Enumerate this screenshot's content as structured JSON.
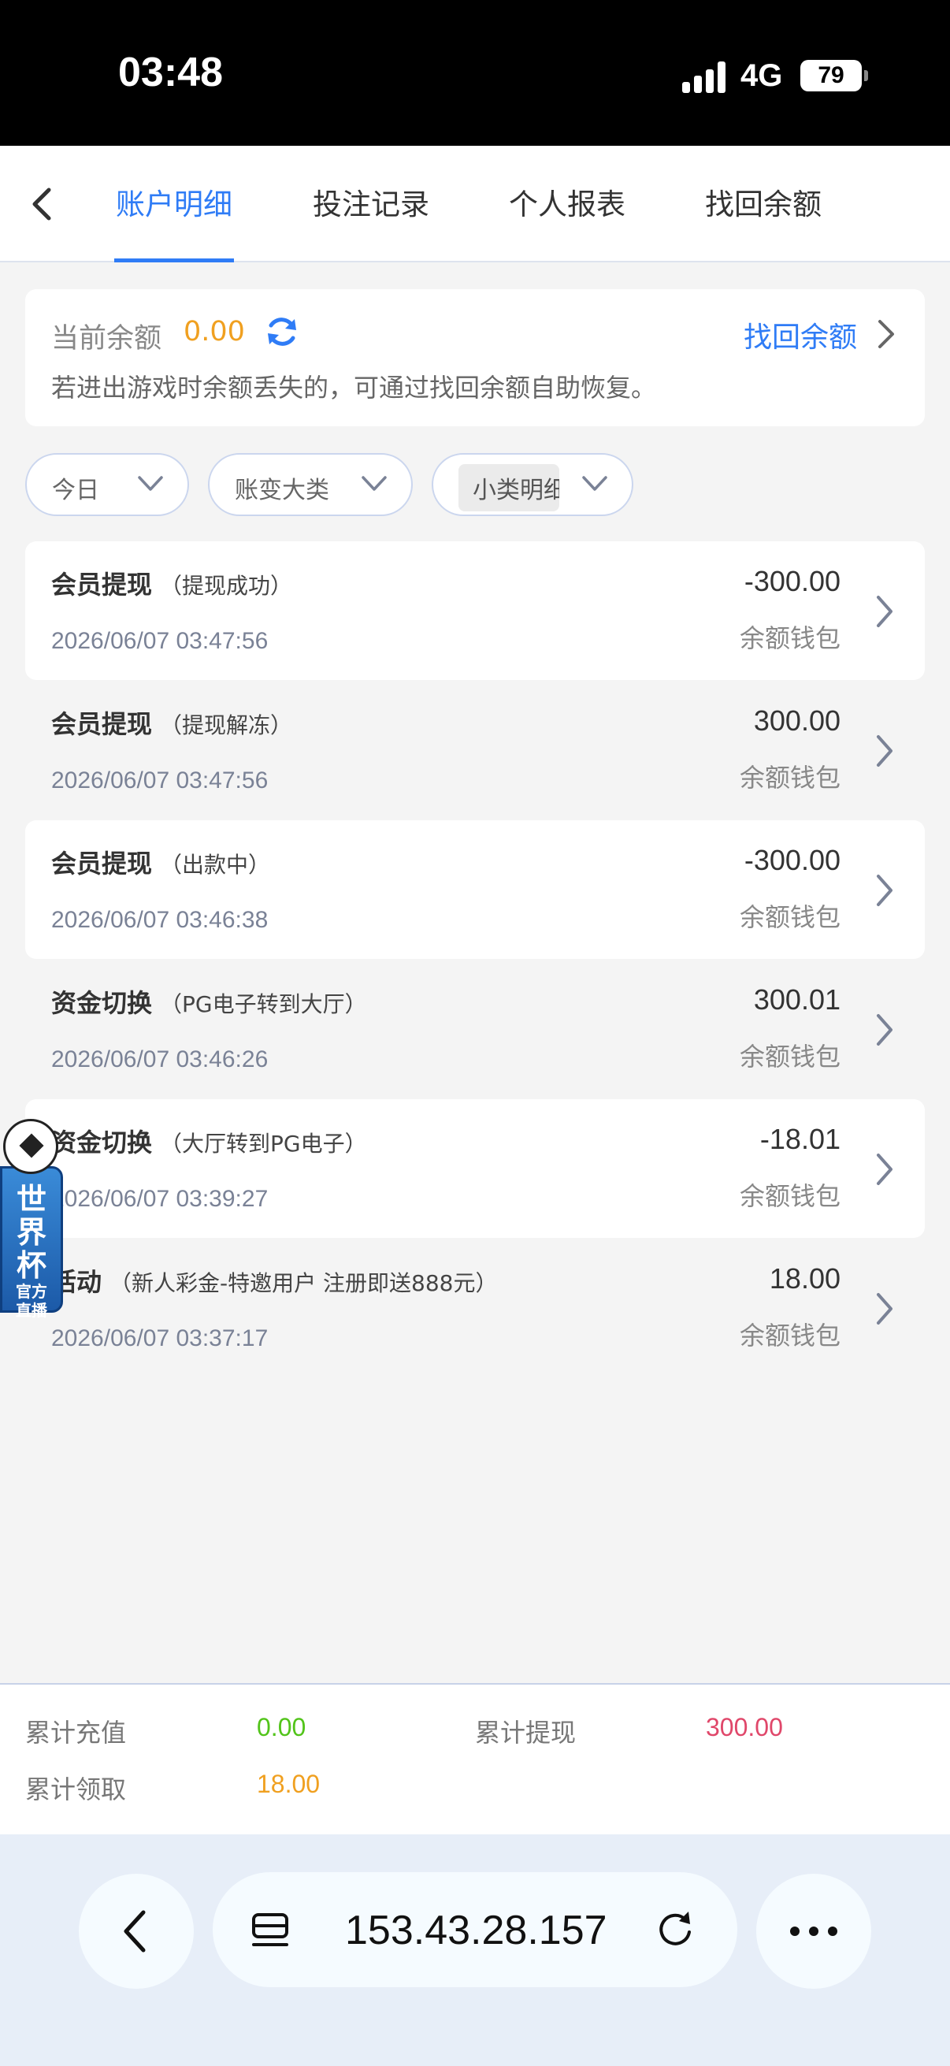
{
  "status_bar": {
    "time": "03:48",
    "network": "4G",
    "battery": "79"
  },
  "tabs": [
    {
      "label": "账户明细",
      "active": true
    },
    {
      "label": "投注记录",
      "active": false
    },
    {
      "label": "个人报表",
      "active": false
    },
    {
      "label": "找回余额",
      "active": false
    }
  ],
  "balance": {
    "label": "当前余额",
    "value": "0.00",
    "recover_link": "找回余额",
    "tip": "若进出游戏时余额丢失的，可通过找回余额自助恢复。"
  },
  "filters": [
    {
      "label": "今日"
    },
    {
      "label": "账变大类"
    },
    {
      "label": "小类明细"
    }
  ],
  "transactions": [
    {
      "title": "会员提现",
      "sub": "（提现成功）",
      "time": "2026/06/07 03:47:56",
      "amount": "-300.00",
      "wallet": "余额钱包"
    },
    {
      "title": "会员提现",
      "sub": "（提现解冻）",
      "time": "2026/06/07 03:47:56",
      "amount": "300.00",
      "wallet": "余额钱包"
    },
    {
      "title": "会员提现",
      "sub": "（出款中）",
      "time": "2026/06/07 03:46:38",
      "amount": "-300.00",
      "wallet": "余额钱包"
    },
    {
      "title": "资金切换",
      "sub": "（PG电子转到大厅）",
      "time": "2026/06/07 03:46:26",
      "amount": "300.01",
      "wallet": "余额钱包"
    },
    {
      "title": "资金切换",
      "sub": "（大厅转到PG电子）",
      "time": "2026/06/07 03:39:27",
      "amount": "-18.01",
      "wallet": "余额钱包"
    },
    {
      "title": "活动",
      "sub": "（新人彩金-特邀用户 注册即送888元）",
      "time": "2026/06/07 03:37:17",
      "amount": "18.00",
      "wallet": "余额钱包"
    }
  ],
  "floating_badge": {
    "title": "世界杯",
    "subtitle_1": "官方",
    "subtitle_2": "直播"
  },
  "summary": {
    "recharge_label": "累计充值",
    "recharge_value": "0.00",
    "withdraw_label": "累计提现",
    "withdraw_value": "300.00",
    "claim_label": "累计领取",
    "claim_value": "18.00"
  },
  "browser": {
    "url": "153.43.28.157"
  },
  "colors": {
    "accent": "#2f7cf6",
    "balance": "#f0a020",
    "recharge": "#52c41a",
    "withdraw": "#e0476a",
    "claim": "#f0a020"
  }
}
